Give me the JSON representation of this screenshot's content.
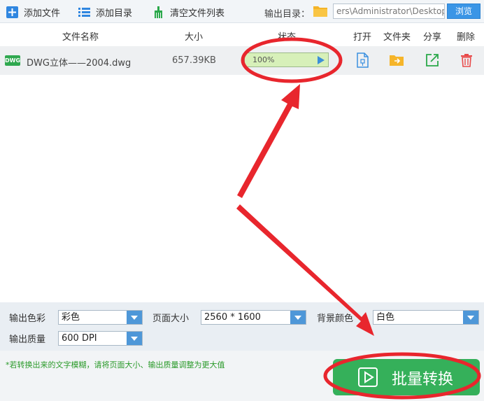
{
  "toolbar": {
    "add_file": "添加文件",
    "add_dir": "添加目录",
    "clear_list": "清空文件列表",
    "output_label": "输出目录：",
    "output_path": "ers\\Administrator\\Desktop",
    "browse": "浏览"
  },
  "table": {
    "headers": {
      "name": "文件名称",
      "size": "大小",
      "status": "状态",
      "open": "打开",
      "folder": "文件夹",
      "share": "分享",
      "delete": "删除"
    },
    "rows": [
      {
        "icon": "DWG",
        "name": "DWG立体——2004.dwg",
        "size": "657.39KB",
        "progress_text": "100%",
        "progress": 1.0
      }
    ]
  },
  "options": {
    "color_label": "输出色彩",
    "color_value": "彩色",
    "page_label": "页面大小",
    "page_value": "2560 * 1600",
    "bg_label": "背景颜色",
    "bg_value": "白色",
    "quality_label": "输出质量",
    "quality_value": "600 DPI"
  },
  "footer": {
    "hint": "*若转换出来的文字模糊，请将页面大小、输出质量调整为更大值",
    "convert": "批量转换"
  },
  "colors": {
    "accent_blue": "#3a95e6",
    "convert_green": "#35b05a",
    "annotation_red": "#e8262d",
    "hint_green": "#2a9a2a"
  }
}
